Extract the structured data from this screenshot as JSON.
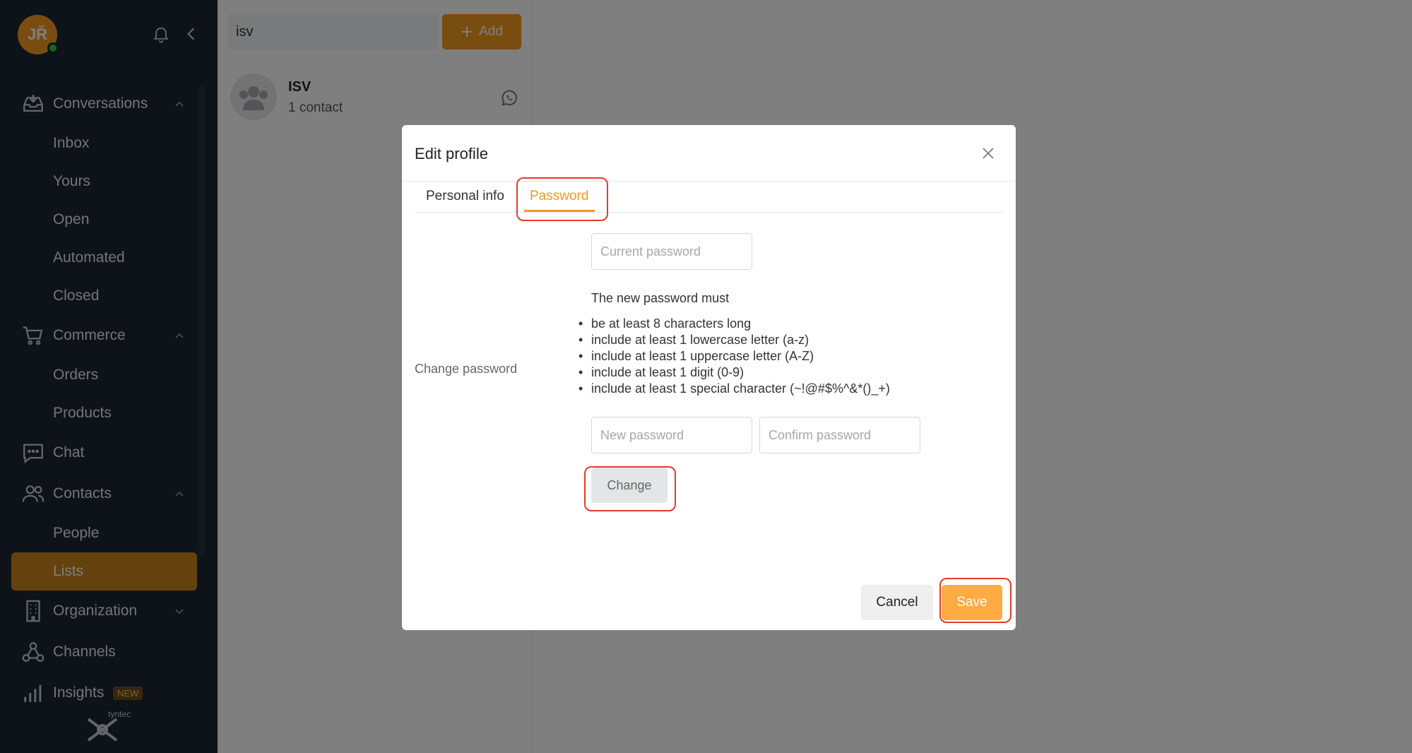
{
  "user": {
    "initials": "JŘ",
    "status": "online"
  },
  "sidebar": {
    "groups": [
      {
        "label": "Conversations",
        "icon": "inbox-tray-icon",
        "expanded": true,
        "items": [
          "Inbox",
          "Yours",
          "Open",
          "Automated",
          "Closed"
        ]
      },
      {
        "label": "Commerce",
        "icon": "cart-icon",
        "expanded": true,
        "items": [
          "Orders",
          "Products"
        ]
      },
      {
        "label": "Chat",
        "icon": "chat-bubble-icon",
        "items": []
      },
      {
        "label": "Contacts",
        "icon": "people-icon",
        "expanded": true,
        "items": [
          "People",
          "Lists"
        ]
      },
      {
        "label": "Organization",
        "icon": "building-icon",
        "expanded": false,
        "items": []
      },
      {
        "label": "Channels",
        "icon": "channels-icon",
        "items": []
      },
      {
        "label": "Insights",
        "icon": "bar-chart-icon",
        "badge": "NEW",
        "items": []
      }
    ],
    "active_item": "Lists",
    "logo_text": "tyntec"
  },
  "panel": {
    "search_value": "isv",
    "add_label": "Add",
    "list": [
      {
        "name": "ISV",
        "subtitle": "1 contact",
        "channel_icon": "whatsapp-icon"
      }
    ]
  },
  "modal": {
    "title": "Edit profile",
    "tabs": [
      "Personal info",
      "Password"
    ],
    "active_tab": "Password",
    "change_password_label": "Change password",
    "current_password_placeholder": "Current password",
    "requirements_title": "The new password must",
    "requirements": [
      "be at least 8 characters long",
      "include at least 1 lowercase letter (a-z)",
      "include at least 1 uppercase letter (A-Z)",
      "include at least 1 digit (0-9)",
      "include at least 1 special character (~!@#$%^&*()_+)"
    ],
    "new_password_placeholder": "New password",
    "confirm_password_placeholder": "Confirm password",
    "change_label": "Change",
    "cancel_label": "Cancel",
    "save_label": "Save"
  },
  "colors": {
    "accent": "#f29a1e",
    "sidebar_bg": "#1b2733",
    "highlight": "#e53b2c"
  }
}
